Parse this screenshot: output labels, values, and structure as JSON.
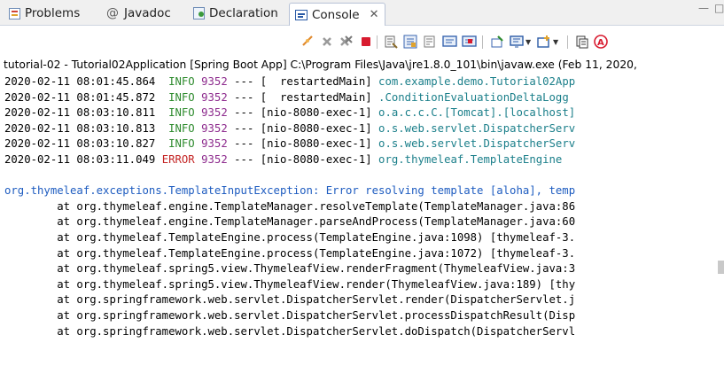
{
  "tabs": [
    {
      "label": "Problems",
      "icon": "problems-icon",
      "active": false
    },
    {
      "label": "Javadoc",
      "icon": "javadoc-icon",
      "active": false
    },
    {
      "label": "Declaration",
      "icon": "declaration-icon",
      "active": false
    },
    {
      "label": "Console",
      "icon": "console-icon",
      "active": true,
      "close": "✕"
    }
  ],
  "window_controls": {
    "minimize": "—",
    "maximize": "□"
  },
  "toolbar": {
    "buttons": [
      {
        "name": "link-icon"
      },
      {
        "name": "remove-launch-icon"
      },
      {
        "name": "remove-all-terminated-icon"
      },
      {
        "name": "terminate-icon"
      },
      {
        "name": "clear-console-icon"
      },
      {
        "name": "scroll-lock-icon"
      },
      {
        "name": "word-wrap-icon"
      },
      {
        "name": "show-stdout-icon"
      },
      {
        "name": "show-stderr-icon"
      },
      {
        "name": "pin-console-icon"
      },
      {
        "name": "display-console-icon"
      },
      {
        "name": "open-console-icon"
      },
      {
        "name": "copy-icon"
      },
      {
        "name": "search-icon"
      }
    ]
  },
  "process_title": "tutorial-02 - Tutorial02Application [Spring Boot App] C:\\Program Files\\Java\\jre1.8.0_101\\bin\\javaw.exe (Feb 11, 2020,",
  "log_lines": [
    {
      "ts": "2020-02-11 08:01:45.864",
      "level": "INFO",
      "pid": "9352",
      "sep": "---",
      "thread": "[  restartedMain]",
      "logger": "com.example.demo.Tutorial02App"
    },
    {
      "ts": "2020-02-11 08:01:45.872",
      "level": "INFO",
      "pid": "9352",
      "sep": "---",
      "thread": "[  restartedMain]",
      "logger": ".ConditionEvaluationDeltaLogg"
    },
    {
      "ts": "2020-02-11 08:03:10.811",
      "level": "INFO",
      "pid": "9352",
      "sep": "---",
      "thread": "[nio-8080-exec-1]",
      "logger": "o.a.c.c.C.[Tomcat].[localhost]"
    },
    {
      "ts": "2020-02-11 08:03:10.813",
      "level": "INFO",
      "pid": "9352",
      "sep": "---",
      "thread": "[nio-8080-exec-1]",
      "logger": "o.s.web.servlet.DispatcherServ"
    },
    {
      "ts": "2020-02-11 08:03:10.827",
      "level": "INFO",
      "pid": "9352",
      "sep": "---",
      "thread": "[nio-8080-exec-1]",
      "logger": "o.s.web.servlet.DispatcherServ"
    },
    {
      "ts": "2020-02-11 08:03:11.049",
      "level": "ERROR",
      "pid": "9352",
      "sep": "---",
      "thread": "[nio-8080-exec-1]",
      "logger": "org.thymeleaf.TemplateEngine"
    }
  ],
  "exception": "org.thymeleaf.exceptions.TemplateInputException: Error resolving template [aloha], temp",
  "stack_trace": [
    "\tat org.thymeleaf.engine.TemplateManager.resolveTemplate(TemplateManager.java:86",
    "\tat org.thymeleaf.engine.TemplateManager.parseAndProcess(TemplateManager.java:60",
    "\tat org.thymeleaf.TemplateEngine.process(TemplateEngine.java:1098) [thymeleaf-3.",
    "\tat org.thymeleaf.TemplateEngine.process(TemplateEngine.java:1072) [thymeleaf-3.",
    "\tat org.thymeleaf.spring5.view.ThymeleafView.renderFragment(ThymeleafView.java:3",
    "\tat org.thymeleaf.spring5.view.ThymeleafView.render(ThymeleafView.java:189) [thy",
    "\tat org.springframework.web.servlet.DispatcherServlet.render(DispatcherServlet.j",
    "\tat org.springframework.web.servlet.DispatcherServlet.processDispatchResult(Disp",
    "\tat org.springframework.web.servlet.DispatcherServlet.doDispatch(DispatcherServl"
  ],
  "colors": {
    "info": "#2e8b2e",
    "error": "#c42525",
    "pid": "#8e2c8e",
    "logger": "#1b7f8a",
    "exception": "#1e5cc0"
  }
}
